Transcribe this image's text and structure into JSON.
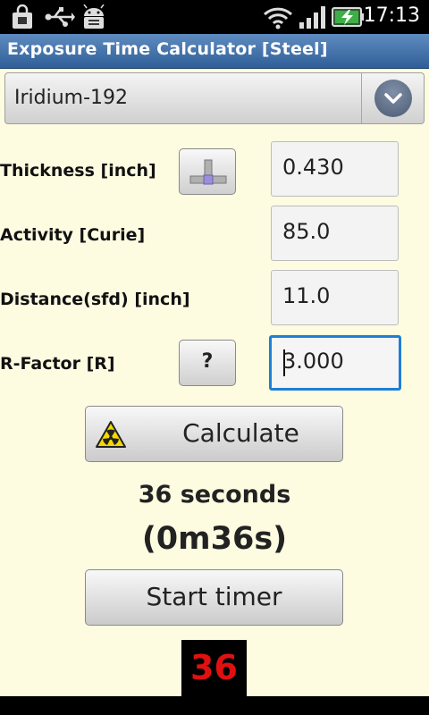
{
  "statusbar": {
    "time": "17:13",
    "icons": [
      "shopping-bag-icon",
      "usb-icon",
      "android-debug-icon",
      "wifi-icon",
      "signal-icon",
      "battery-charging-icon"
    ]
  },
  "titlebar": {
    "title": "Exposure Time Calculator [Steel]"
  },
  "isotope": {
    "selected": "Iridium-192"
  },
  "rows": {
    "thickness": {
      "label": "Thickness [inch]",
      "value": "0.430"
    },
    "activity": {
      "label": "Activity [Curie]",
      "value": "85.0"
    },
    "distance": {
      "label": "Distance(sfd) [inch]",
      "value": "11.0"
    },
    "rfactor": {
      "label": "R-Factor [R]",
      "value": "3.000",
      "help_label": "?"
    }
  },
  "calculate": {
    "label": "Calculate"
  },
  "result": {
    "seconds": "36 seconds",
    "formatted": "(0m36s)"
  },
  "timer": {
    "button_label": "Start timer",
    "count": "36"
  },
  "colors": {
    "title_bar": "#3f6fa8",
    "background": "#fdfbe0",
    "focus": "#1e7fd6",
    "counter_text": "#e11010"
  }
}
